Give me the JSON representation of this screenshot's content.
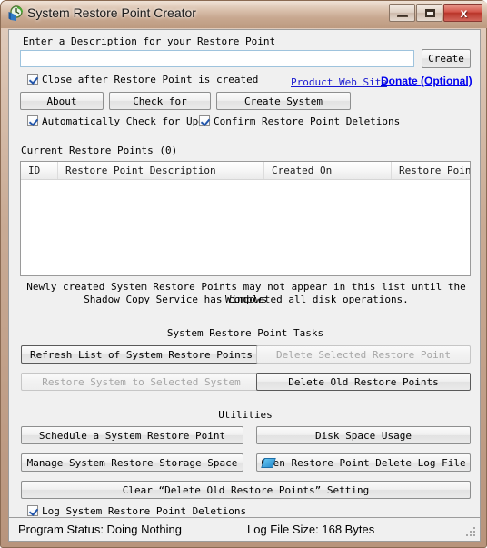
{
  "window": {
    "title": "System Restore Point Creator",
    "app_icon": "restore-clock-icon",
    "minimize_label": "",
    "maximize_label": "",
    "close_label": "x"
  },
  "description": {
    "label": "Enter a Description for your Restore Point",
    "value": "",
    "placeholder": "",
    "create_label": "Create"
  },
  "options": {
    "close_after": "Close after Restore Point is created",
    "auto_check": "Automatically Check for Updates",
    "confirm_deletions": "Confirm Restore Point Deletions",
    "log_deletions": "Log System Restore Point Deletions"
  },
  "links": {
    "web_site": "Product Web Site",
    "donate": "Donate (Optional)"
  },
  "top_buttons": {
    "about": "About",
    "check_for": "Check for",
    "create_system": "Create System"
  },
  "restore_points": {
    "group_label": "Current Restore Points (0)",
    "columns": [
      "ID",
      "Restore Point Description",
      "Created On",
      "Restore Point Type"
    ],
    "rows": [],
    "note_line1": "Newly created System Restore Points may not appear in this list until the Windows",
    "note_line2": "Shadow Copy Service has completed all disk operations."
  },
  "tasks": {
    "title": "System Restore Point Tasks",
    "refresh": "Refresh List of System Restore Points",
    "delete_selected": "Delete Selected Restore Point",
    "restore_to_selected": "Restore System to Selected System",
    "delete_old": "Delete Old Restore Points"
  },
  "utilities": {
    "title": "Utilities",
    "schedule": "Schedule a System Restore Point",
    "disk_space": "Disk Space Usage",
    "manage_storage": "Manage System Restore Storage Space",
    "open_log": "Open Restore Point Delete Log File",
    "clear_setting": "Clear “Delete Old Restore Points” Setting"
  },
  "status": {
    "program_status": "Program Status:  Doing Nothing",
    "log_file_size": "Log File Size:  168 Bytes"
  },
  "colors": {
    "frame": "#b8947c",
    "client_bg": "#f0f0f0",
    "link": "#1a1ad0",
    "donate_link": "#0000ee",
    "close_button": "#b9352a"
  }
}
